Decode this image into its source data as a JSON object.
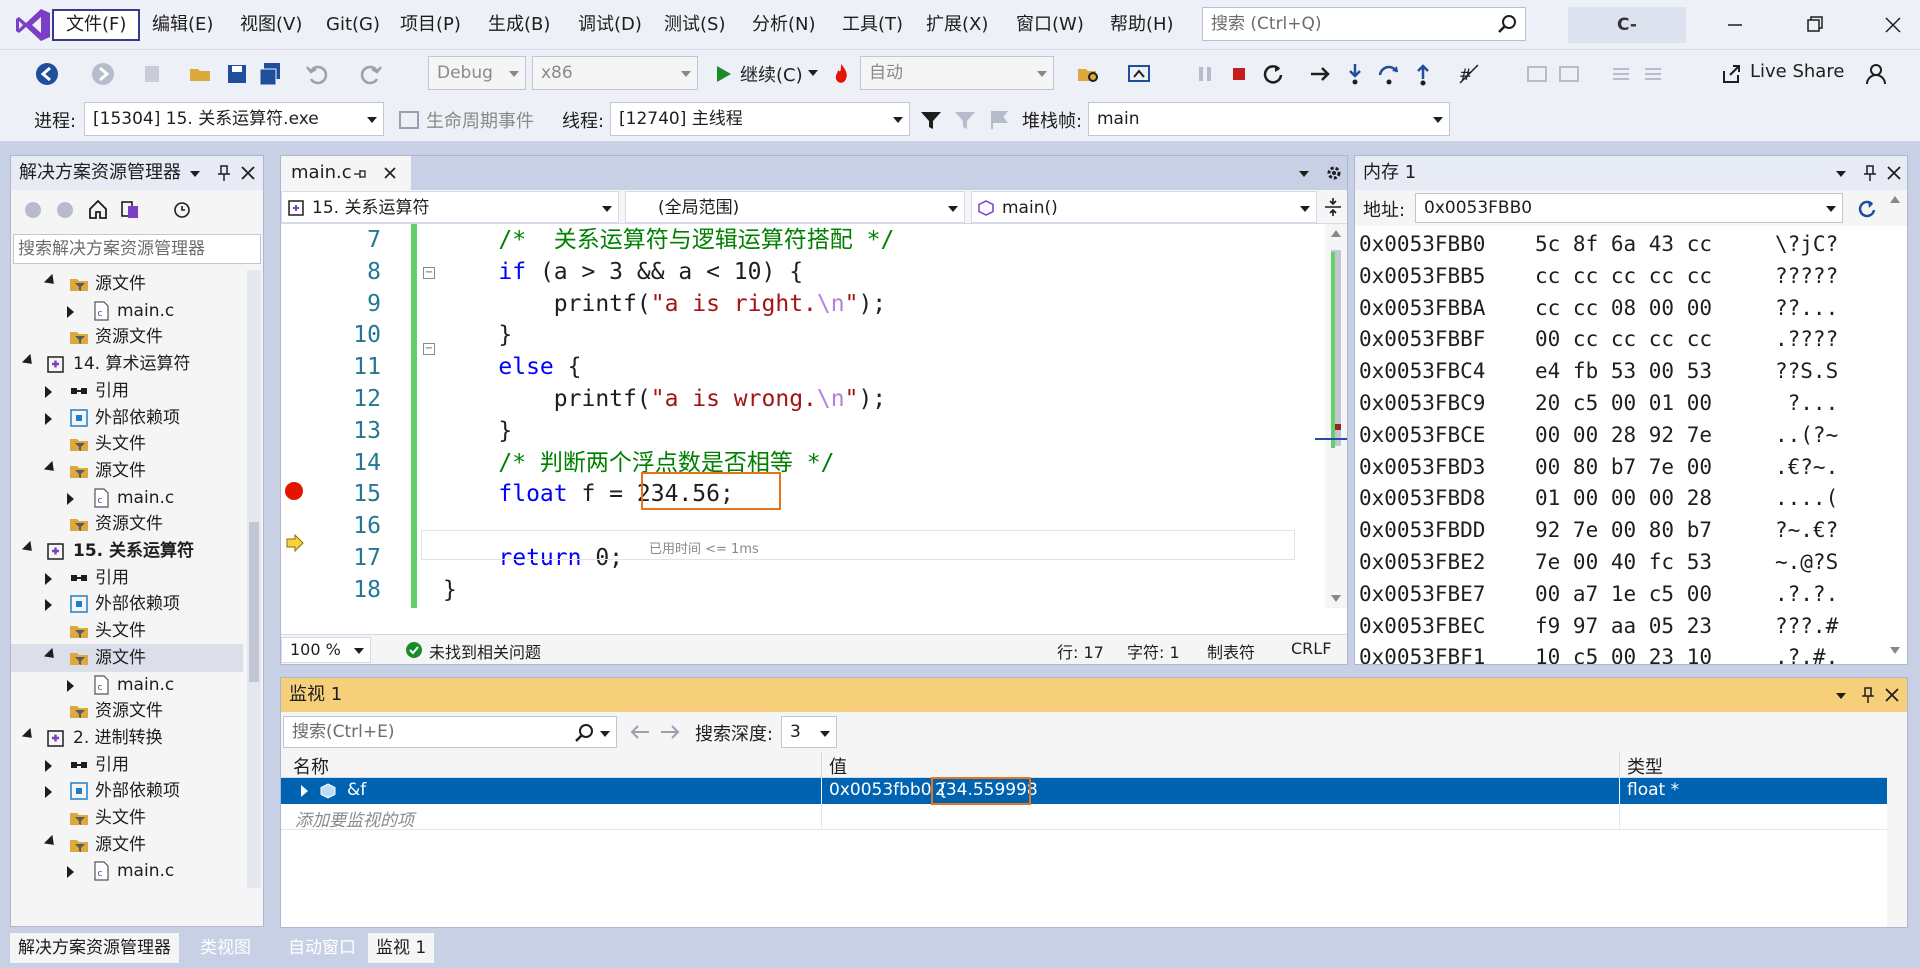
{
  "menubar": {
    "items": [
      "文件(F)",
      "编辑(E)",
      "视图(V)",
      "Git(G)",
      "项目(P)",
      "生成(B)",
      "调试(D)",
      "测试(S)",
      "分析(N)",
      "工具(T)",
      "扩展(X)",
      "窗口(W)",
      "帮助(H)"
    ],
    "search_placeholder": "搜索 (Ctrl+Q)",
    "profile": "C-supervisor"
  },
  "toolbar": {
    "config": "Debug",
    "platform": "x86",
    "continue_label": "继续(C)",
    "auto": "自动",
    "live_share": "Live Share"
  },
  "debugbar": {
    "process_label": "进程:",
    "process_value": "[15304] 15. 关系运算符.exe",
    "lifecycle_label": "生命周期事件",
    "thread_label": "线程:",
    "thread_value": "[12740] 主线程",
    "stack_label": "堆栈帧:",
    "stack_value": "main"
  },
  "solution_explorer": {
    "title": "解决方案资源管理器",
    "search_placeholder": "搜索解决方案资源管理器",
    "rows": [
      {
        "label": "源文件",
        "icon": "folder-filter-icon",
        "indent": 2,
        "caret": "down"
      },
      {
        "label": "main.c",
        "icon": "c-file-icon",
        "indent": 3,
        "caret": "right"
      },
      {
        "label": "资源文件",
        "icon": "folder-filter-icon",
        "indent": 2,
        "caret": ""
      },
      {
        "label": "14. 算术运算符",
        "icon": "project-icon",
        "indent": 1,
        "caret": "down"
      },
      {
        "label": "引用",
        "icon": "references-icon",
        "indent": 2,
        "caret": "right"
      },
      {
        "label": "外部依赖项",
        "icon": "external-deps-icon",
        "indent": 2,
        "caret": "right"
      },
      {
        "label": "头文件",
        "icon": "folder-filter-icon",
        "indent": 2,
        "caret": ""
      },
      {
        "label": "源文件",
        "icon": "folder-filter-icon",
        "indent": 2,
        "caret": "down"
      },
      {
        "label": "main.c",
        "icon": "c-file-icon",
        "indent": 3,
        "caret": "right"
      },
      {
        "label": "资源文件",
        "icon": "folder-filter-icon",
        "indent": 2,
        "caret": ""
      },
      {
        "label": "15. 关系运算符",
        "icon": "project-icon",
        "indent": 1,
        "caret": "down",
        "bold": true
      },
      {
        "label": "引用",
        "icon": "references-icon",
        "indent": 2,
        "caret": "right"
      },
      {
        "label": "外部依赖项",
        "icon": "external-deps-icon",
        "indent": 2,
        "caret": "right"
      },
      {
        "label": "头文件",
        "icon": "folder-filter-icon",
        "indent": 2,
        "caret": ""
      },
      {
        "label": "源文件",
        "icon": "folder-filter-icon",
        "indent": 2,
        "caret": "down",
        "selected": true
      },
      {
        "label": "main.c",
        "icon": "c-file-icon",
        "indent": 3,
        "caret": "right"
      },
      {
        "label": "资源文件",
        "icon": "folder-filter-icon",
        "indent": 2,
        "caret": ""
      },
      {
        "label": "2. 进制转换",
        "icon": "project-icon",
        "indent": 1,
        "caret": "down"
      },
      {
        "label": "引用",
        "icon": "references-icon",
        "indent": 2,
        "caret": "right"
      },
      {
        "label": "外部依赖项",
        "icon": "external-deps-icon",
        "indent": 2,
        "caret": "right"
      },
      {
        "label": "头文件",
        "icon": "folder-filter-icon",
        "indent": 2,
        "caret": ""
      },
      {
        "label": "源文件",
        "icon": "folder-filter-icon",
        "indent": 2,
        "caret": "down"
      },
      {
        "label": "main.c",
        "icon": "c-file-icon",
        "indent": 3,
        "caret": "right"
      },
      {
        "label": "资源文件",
        "icon": "folder-filter-icon",
        "indent": 2,
        "caret": ""
      }
    ]
  },
  "editor": {
    "tab": "main.c",
    "nav_project": "15. 关系运算符",
    "nav_scope": "(全局范围)",
    "nav_function": "main()",
    "lines": [
      {
        "num": "7",
        "tokens": [
          {
            "t": "    ",
            "c": ""
          },
          {
            "t": "/*  关系运算符与逻辑运算符搭配 */",
            "c": "cm"
          }
        ]
      },
      {
        "num": "8",
        "tokens": [
          {
            "t": "    ",
            "c": ""
          },
          {
            "t": "if",
            "c": "kw"
          },
          {
            "t": " (a > 3 && a < 10) {",
            "c": ""
          }
        ]
      },
      {
        "num": "9",
        "tokens": [
          {
            "t": "        printf(",
            "c": ""
          },
          {
            "t": "\"a is right.",
            "c": "str"
          },
          {
            "t": "\\n",
            "c": "esc"
          },
          {
            "t": "\"",
            "c": "str"
          },
          {
            "t": ");",
            "c": ""
          }
        ]
      },
      {
        "num": "10",
        "tokens": [
          {
            "t": "    }",
            "c": ""
          }
        ]
      },
      {
        "num": "11",
        "tokens": [
          {
            "t": "    ",
            "c": ""
          },
          {
            "t": "else",
            "c": "kw"
          },
          {
            "t": " {",
            "c": ""
          }
        ]
      },
      {
        "num": "12",
        "tokens": [
          {
            "t": "        printf(",
            "c": ""
          },
          {
            "t": "\"a is wrong.",
            "c": "str"
          },
          {
            "t": "\\n",
            "c": "esc"
          },
          {
            "t": "\"",
            "c": "str"
          },
          {
            "t": ");",
            "c": ""
          }
        ]
      },
      {
        "num": "13",
        "tokens": [
          {
            "t": "    }",
            "c": ""
          }
        ]
      },
      {
        "num": "14",
        "tokens": [
          {
            "t": "    ",
            "c": ""
          },
          {
            "t": "/* 判断两个浮点数是否相等 */",
            "c": "cm"
          }
        ]
      },
      {
        "num": "15",
        "tokens": [
          {
            "t": "    ",
            "c": ""
          },
          {
            "t": "float",
            "c": "kw"
          },
          {
            "t": " f = 234.56;",
            "c": ""
          }
        ]
      },
      {
        "num": "16",
        "tokens": []
      },
      {
        "num": "17",
        "tokens": [
          {
            "t": "    ",
            "c": ""
          },
          {
            "t": "return",
            "c": "kw"
          },
          {
            "t": " 0;",
            "c": ""
          }
        ]
      },
      {
        "num": "18",
        "tokens": [
          {
            "t": "}",
            "c": ""
          }
        ]
      }
    ],
    "elapsed": "已用时间 <= 1ms",
    "status": {
      "zoom": "100 %",
      "issues": "未找到相关问题",
      "line": "行: 17",
      "char": "字符: 1",
      "tab": "制表符",
      "eol": "CRLF"
    }
  },
  "memory": {
    "title": "内存 1",
    "address_label": "地址:",
    "address_value": "0x0053FBB0",
    "rows": [
      {
        "addr": "0x0053FBB0",
        "bytes": "5c 8f 6a 43 cc",
        "chars": "\\?jC?"
      },
      {
        "addr": "0x0053FBB5",
        "bytes": "cc cc cc cc cc",
        "chars": "?????"
      },
      {
        "addr": "0x0053FBBA",
        "bytes": "cc cc 08 00 00",
        "chars": "??..."
      },
      {
        "addr": "0x0053FBBF",
        "bytes": "00 cc cc cc cc",
        "chars": ".????"
      },
      {
        "addr": "0x0053FBC4",
        "bytes": "e4 fb 53 00 53",
        "chars": "??S.S"
      },
      {
        "addr": "0x0053FBC9",
        "bytes": "20 c5 00 01 00",
        "chars": " ?..."
      },
      {
        "addr": "0x0053FBCE",
        "bytes": "00 00 28 92 7e",
        "chars": "..(?~"
      },
      {
        "addr": "0x0053FBD3",
        "bytes": "00 80 b7 7e 00",
        "chars": ".€?~."
      },
      {
        "addr": "0x0053FBD8",
        "bytes": "01 00 00 00 28",
        "chars": "....("
      },
      {
        "addr": "0x0053FBDD",
        "bytes": "92 7e 00 80 b7",
        "chars": "?~.€?"
      },
      {
        "addr": "0x0053FBE2",
        "bytes": "7e 00 40 fc 53",
        "chars": "~.@?S"
      },
      {
        "addr": "0x0053FBE7",
        "bytes": "00 a7 1e c5 00",
        "chars": ".?.?."
      },
      {
        "addr": "0x0053FBEC",
        "bytes": "f9 97 aa 05 23",
        "chars": "???.#"
      },
      {
        "addr": "0x0053FBF1",
        "bytes": "10 c5 00 23 10",
        "chars": ".?.#."
      }
    ]
  },
  "watch": {
    "title": "监视 1",
    "search_placeholder": "搜索(Ctrl+E)",
    "depth_label": "搜索深度:",
    "depth_value": "3",
    "columns": [
      "名称",
      "值",
      "类型"
    ],
    "rows": [
      {
        "name": "&f",
        "value_addr": "0x0053fbb0 {",
        "value": "234.559998",
        "type": "float *"
      }
    ],
    "add_placeholder": "添加要监视的项"
  },
  "bottom_tabs": {
    "left": [
      "解决方案资源管理器",
      "类视图"
    ],
    "right": [
      "自动窗口",
      "监视 1"
    ]
  },
  "colors": {
    "accent": "#0078d7",
    "highlight": "#e8731e",
    "breakpoint": "#e51400",
    "selection": "#0063b1"
  }
}
